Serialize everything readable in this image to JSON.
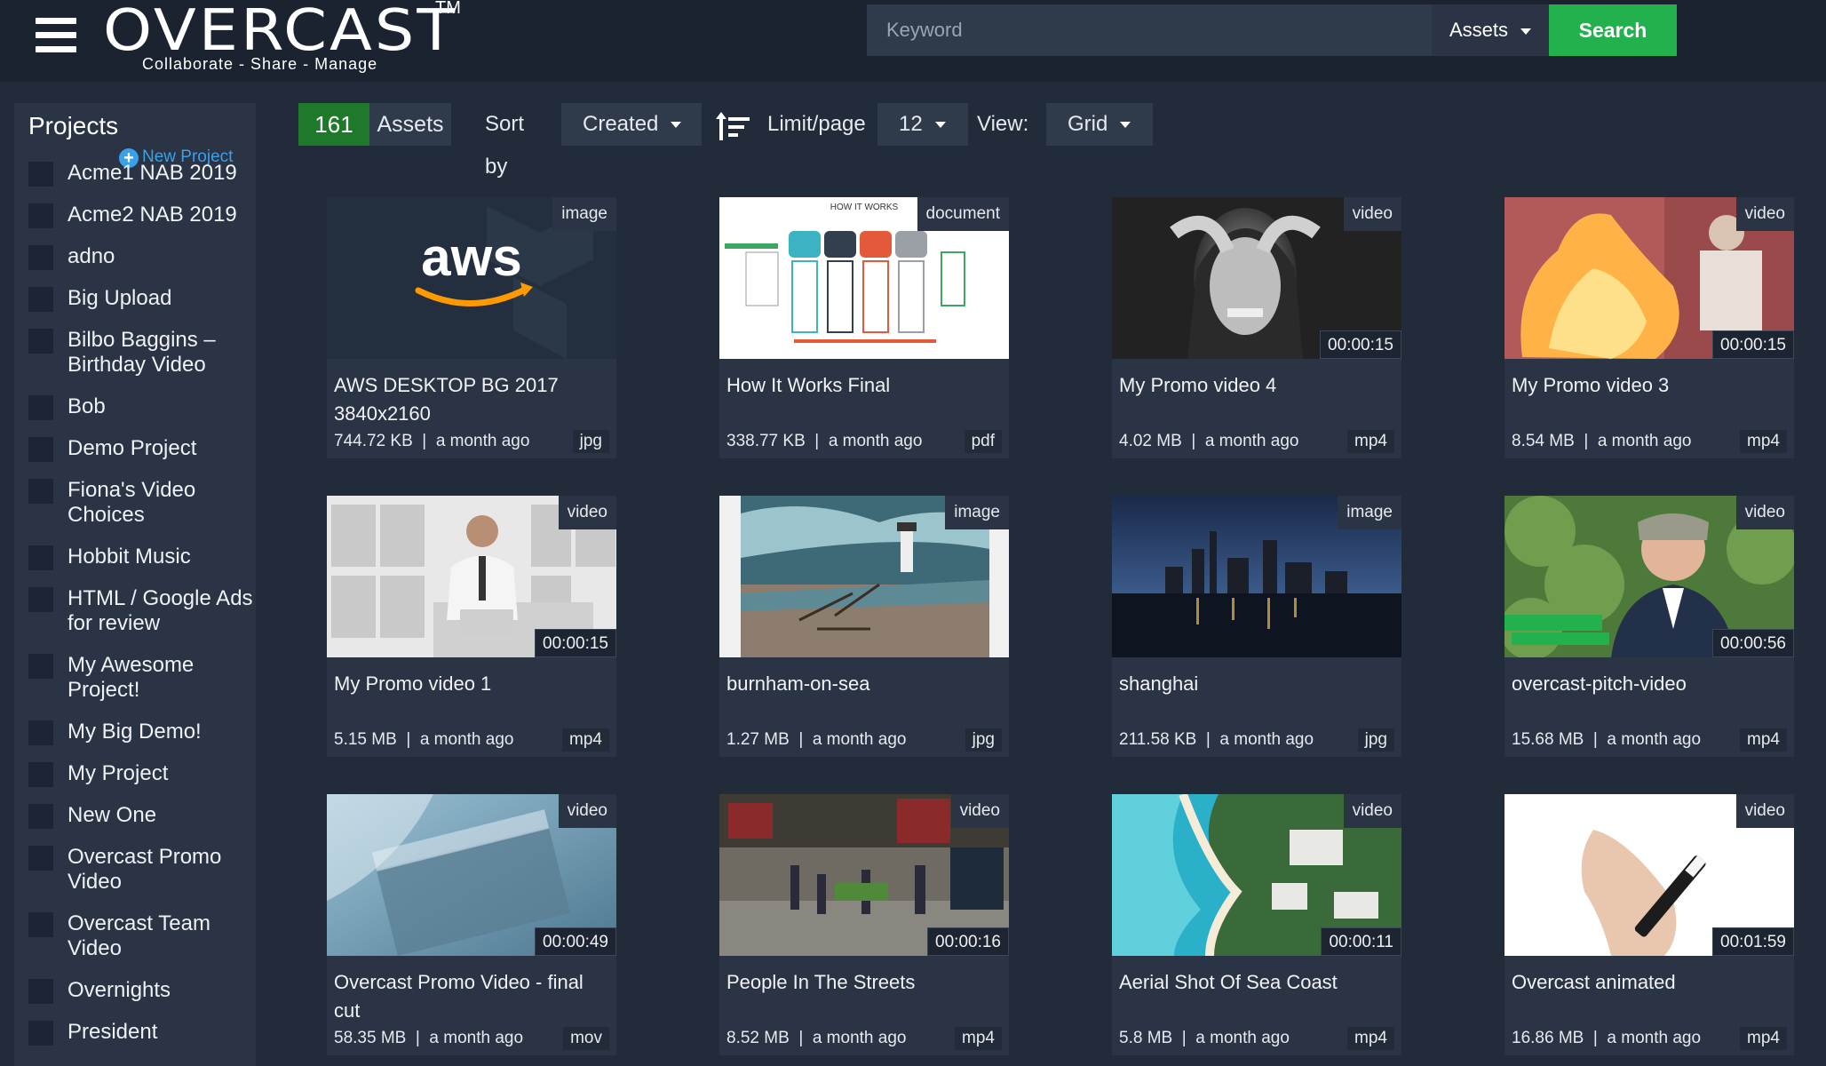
{
  "header": {
    "logo": "OVERCAST",
    "trademark": "TM",
    "tagline": "Collaborate - Share - Manage",
    "search_placeholder": "Keyword",
    "search_scope": "Assets",
    "search_button": "Search"
  },
  "sidebar": {
    "title": "Projects",
    "new_project": "New Project",
    "projects": [
      "Acme1 NAB 2019",
      "Acme2 NAB 2019",
      "adno",
      "Big Upload",
      "Bilbo Baggins – Birthday Video",
      "Bob",
      "Demo Project",
      "Fiona's Video Choices",
      "Hobbit Music",
      "HTML / Google Ads for review",
      "My Awesome Project!",
      "My Big Demo!",
      "My Project",
      "New One",
      "Overcast Promo Video",
      "Overcast Team Video",
      "Overnights",
      "President"
    ]
  },
  "toolbar": {
    "count": "161",
    "count_label": "Assets",
    "sort_label": "Sort by",
    "sort_value": "Created",
    "limit_label": "Limit/page",
    "limit_value": "12",
    "view_label": "View:",
    "view_value": "Grid"
  },
  "assets": [
    {
      "title": "AWS DESKTOP BG 2017 3840x2160",
      "type": "image",
      "size": "744.72 KB",
      "age": "a month ago",
      "ext": "jpg",
      "duration": ""
    },
    {
      "title": "How It Works Final",
      "type": "document",
      "size": "338.77 KB",
      "age": "a month ago",
      "ext": "pdf",
      "duration": ""
    },
    {
      "title": "My Promo video 4",
      "type": "video",
      "size": "4.02 MB",
      "age": "a month ago",
      "ext": "mp4",
      "duration": "00:00:15"
    },
    {
      "title": "My Promo video 3",
      "type": "video",
      "size": "8.54 MB",
      "age": "a month ago",
      "ext": "mp4",
      "duration": "00:00:15"
    },
    {
      "title": "My Promo video 1",
      "type": "video",
      "size": "5.15 MB",
      "age": "a month ago",
      "ext": "mp4",
      "duration": "00:00:15"
    },
    {
      "title": "burnham-on-sea",
      "type": "image",
      "size": "1.27 MB",
      "age": "a month ago",
      "ext": "jpg",
      "duration": ""
    },
    {
      "title": "shanghai",
      "type": "image",
      "size": "211.58 KB",
      "age": "a month ago",
      "ext": "jpg",
      "duration": ""
    },
    {
      "title": "overcast-pitch-video",
      "type": "video",
      "size": "15.68 MB",
      "age": "a month ago",
      "ext": "mp4",
      "duration": "00:00:56"
    },
    {
      "title": "Overcast Promo Video - final cut",
      "type": "video",
      "size": "58.35 MB",
      "age": "a month ago",
      "ext": "mov",
      "duration": "00:00:49"
    },
    {
      "title": "People In The Streets",
      "type": "video",
      "size": "8.52 MB",
      "age": "a month ago",
      "ext": "mp4",
      "duration": "00:00:16"
    },
    {
      "title": "Aerial Shot Of Sea Coast",
      "type": "video",
      "size": "5.8 MB",
      "age": "a month ago",
      "ext": "mp4",
      "duration": "00:00:11"
    },
    {
      "title": "Overcast animated",
      "type": "video",
      "size": "16.86 MB",
      "age": "a month ago",
      "ext": "mp4",
      "duration": "00:01:59"
    }
  ],
  "thumb_texts": {
    "aws_logo": "aws",
    "doc_heading": "HOW IT WORKS"
  },
  "colors": {
    "accent_green": "#22b14c",
    "count_green": "#1e7a2a",
    "link_blue": "#3aa0e8",
    "aws_orange": "#ff9900"
  }
}
